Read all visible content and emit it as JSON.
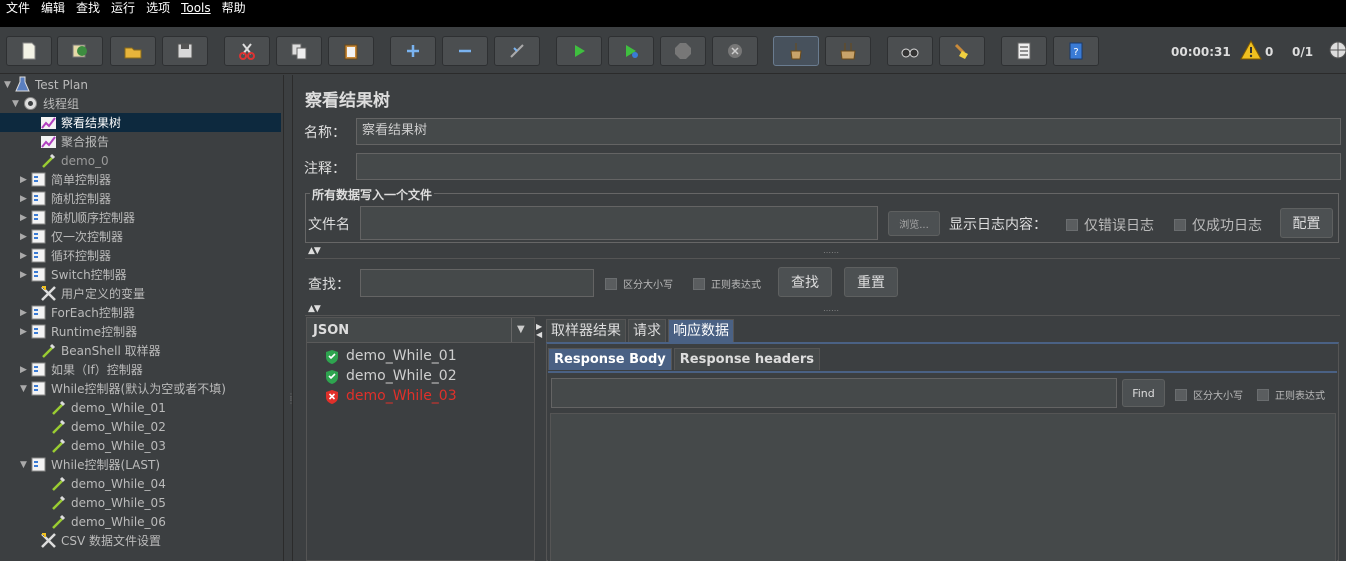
{
  "menu": [
    "文件",
    "编辑",
    "查找",
    "运行",
    "选项",
    "Tools",
    "帮助"
  ],
  "toolbar": {
    "buttons": [
      {
        "name": "new-icon"
      },
      {
        "name": "templates-icon"
      },
      {
        "name": "open-icon"
      },
      {
        "name": "save-icon"
      },
      {
        "name": "cut-icon"
      },
      {
        "name": "copy-icon"
      },
      {
        "name": "paste-icon"
      },
      {
        "name": "expand-icon"
      },
      {
        "name": "collapse-icon"
      },
      {
        "name": "toggle-icon"
      },
      {
        "name": "start-icon"
      },
      {
        "name": "start-no-pause-icon"
      },
      {
        "name": "stop-icon"
      },
      {
        "name": "shutdown-icon"
      },
      {
        "name": "clear-icon"
      },
      {
        "name": "clear-all-icon"
      },
      {
        "name": "search-icon"
      },
      {
        "name": "reset-search-icon"
      },
      {
        "name": "function-helper-icon"
      },
      {
        "name": "help-icon"
      }
    ],
    "timer": "00:00:31",
    "warnings": "0",
    "threads": "0/1"
  },
  "tree": [
    {
      "label": "Test Plan",
      "toggle": "▼",
      "icon": "flask-icon"
    },
    {
      "label": "线程组",
      "toggle": "▼",
      "icon": "gear-icon"
    },
    {
      "label": "察看结果树",
      "toggle": "",
      "icon": "chart-icon",
      "selected": true
    },
    {
      "label": "聚合报告",
      "toggle": "",
      "icon": "chart-icon"
    },
    {
      "label": "demo_0",
      "toggle": "",
      "icon": "pipette-icon",
      "dim": true
    },
    {
      "label": "简单控制器",
      "toggle": "▶",
      "icon": "controller-icon"
    },
    {
      "label": "随机控制器",
      "toggle": "▶",
      "icon": "controller-icon"
    },
    {
      "label": "随机顺序控制器",
      "toggle": "▶",
      "icon": "controller-icon"
    },
    {
      "label": "仅一次控制器",
      "toggle": "▶",
      "icon": "controller-icon"
    },
    {
      "label": "循环控制器",
      "toggle": "▶",
      "icon": "controller-icon"
    },
    {
      "label": "Switch控制器",
      "toggle": "▶",
      "icon": "controller-icon"
    },
    {
      "label": "用户定义的变量",
      "toggle": "",
      "icon": "tools-icon"
    },
    {
      "label": "ForEach控制器",
      "toggle": "▶",
      "icon": "controller-icon"
    },
    {
      "label": "Runtime控制器",
      "toggle": "▶",
      "icon": "controller-icon"
    },
    {
      "label": "BeanShell 取样器",
      "toggle": "",
      "icon": "pipette-icon"
    },
    {
      "label": "如果（If）控制器",
      "toggle": "▶",
      "icon": "controller-icon"
    },
    {
      "label": "While控制器(默认为空或者不填)",
      "toggle": "▼",
      "icon": "controller-icon"
    },
    {
      "label": "demo_While_01",
      "toggle": "",
      "icon": "pipette-icon"
    },
    {
      "label": "demo_While_02",
      "toggle": "",
      "icon": "pipette-icon"
    },
    {
      "label": "demo_While_03",
      "toggle": "",
      "icon": "pipette-icon"
    },
    {
      "label": "While控制器(LAST)",
      "toggle": "▼",
      "icon": "controller-icon"
    },
    {
      "label": "demo_While_04",
      "toggle": "",
      "icon": "pipette-icon"
    },
    {
      "label": "demo_While_05",
      "toggle": "",
      "icon": "pipette-icon"
    },
    {
      "label": "demo_While_06",
      "toggle": "",
      "icon": "pipette-icon"
    },
    {
      "label": "CSV 数据文件设置",
      "toggle": "",
      "icon": "tools-icon"
    }
  ],
  "panel": {
    "title": "察看结果树",
    "name_label": "名称：",
    "name_value": "察看结果树",
    "comment_label": "注释：",
    "comment_value": "",
    "file_group_label": "所有数据写入一个文件",
    "filename_label": "文件名",
    "filename_value": "",
    "browse_label": "浏览...",
    "log_label": "显示日志内容：",
    "errors_only": "仅错误日志",
    "success_only": "仅成功日志",
    "config_label": "配置",
    "search_label": "查找：",
    "search_value": "",
    "case_sensitive": "区分大小写",
    "regex": "正则表达式",
    "find_label": "查找",
    "reset_label": "重置"
  },
  "results": {
    "renderer": "JSON",
    "items": [
      {
        "label": "demo_While_01",
        "status": "success"
      },
      {
        "label": "demo_While_02",
        "status": "success"
      },
      {
        "label": "demo_While_03",
        "status": "error"
      }
    ]
  },
  "detail": {
    "tabs": [
      "取样器结果",
      "请求",
      "响应数据"
    ],
    "active_tab": 2,
    "subtabs": [
      "Response Body",
      "Response headers"
    ],
    "find_label": "Find",
    "case_sensitive": "区分大小写",
    "regex": "正则表达式",
    "body": ""
  },
  "colors": {
    "background": "#3c3f41",
    "selection": "#0d293e",
    "success": "#2ea44f",
    "error": "#e0302a",
    "active_tab": "#4a6184"
  }
}
